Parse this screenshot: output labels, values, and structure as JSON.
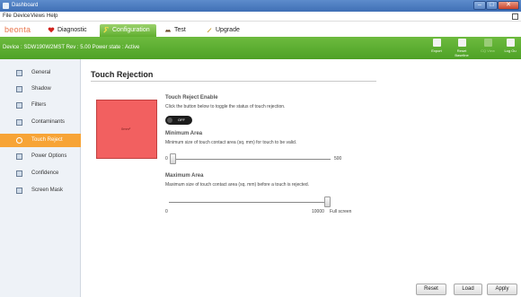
{
  "window": {
    "title": "Dashboard"
  },
  "menu": {
    "items": [
      "File",
      "Device",
      "Views",
      "Help"
    ]
  },
  "brand": "beonta",
  "tabs": [
    {
      "label": "Diagnostic",
      "icon": "heart-icon"
    },
    {
      "label": "Configuration",
      "icon": "wrench-icon",
      "active": true
    },
    {
      "label": "Test",
      "icon": "hands-icon"
    },
    {
      "label": "Upgrade",
      "icon": "rocket-icon"
    }
  ],
  "device_status": "Device : SDW190W2MST Rev : 5.00 Power state : Active",
  "toolbar": [
    {
      "label": "Export",
      "icon": "export-icon",
      "enabled": true
    },
    {
      "label": "Reset Baseline",
      "icon": "reset-baseline-icon",
      "enabled": true
    },
    {
      "label": "CQ View",
      "icon": "cq-view-icon",
      "enabled": false
    },
    {
      "label": "Log Ou",
      "icon": "log-out-icon",
      "enabled": true
    }
  ],
  "sidebar": {
    "items": [
      {
        "label": "General",
        "icon": "monitor-icon"
      },
      {
        "label": "Shadow",
        "icon": "shadow-icon"
      },
      {
        "label": "Filters",
        "icon": "filter-icon"
      },
      {
        "label": "Contaminants",
        "icon": "contaminants-icon"
      },
      {
        "label": "Touch Reject",
        "icon": "no-touch-icon",
        "active": true
      },
      {
        "label": "Power Options",
        "icon": "power-icon"
      },
      {
        "label": "Confidence",
        "icon": "confidence-icon"
      },
      {
        "label": "Screen Mask",
        "icon": "screen-mask-icon"
      }
    ]
  },
  "main": {
    "title": "Touch Rejection",
    "preview_label": "0mm²",
    "enable": {
      "heading": "Touch Reject Enable",
      "description": "Click the button below to toggle the status of touch rejection.",
      "toggle_label": "OFF"
    },
    "min_area": {
      "heading": "Minimum Area",
      "description": "Minimum size of touch contact area (sq. mm) for touch to be valid.",
      "min": "0",
      "max": "500",
      "value": 0
    },
    "max_area": {
      "heading": "Maximum Area",
      "description": "Maximum size of touch contact area (sq. mm) before a touch is rejected.",
      "min": "0",
      "max": "10000",
      "max_note": "Full screen",
      "value": 10000
    }
  },
  "buttons": {
    "reset": "Reset",
    "load": "Load",
    "apply": "Apply"
  }
}
